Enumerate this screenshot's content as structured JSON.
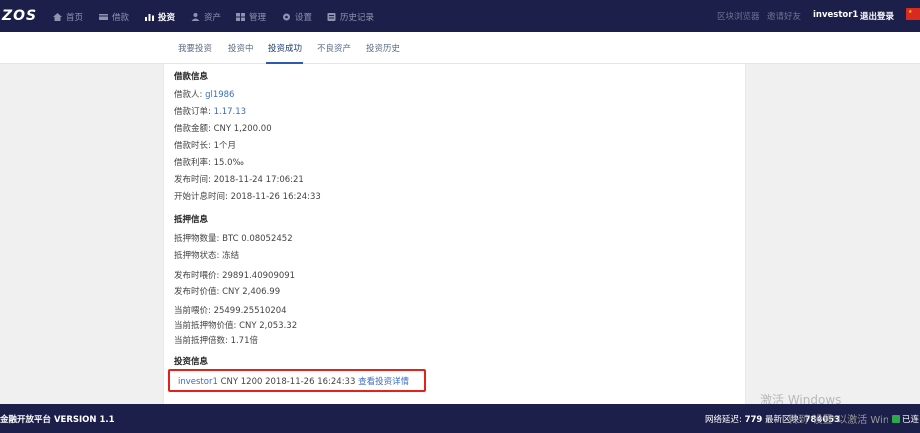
{
  "topbar": {
    "logo": "ZOS",
    "nav": [
      {
        "label": "首页",
        "icon": "home-icon"
      },
      {
        "label": "借款",
        "icon": "card-icon"
      },
      {
        "label": "投资",
        "icon": "bar-chart-icon"
      },
      {
        "label": "资产",
        "icon": "user-icon"
      },
      {
        "label": "管理",
        "icon": "grid-icon"
      },
      {
        "label": "设置",
        "icon": "gear-icon"
      },
      {
        "label": "历史记录",
        "icon": "history-icon"
      }
    ],
    "block_explorer": "区块浏览器",
    "invite": "邀请好友",
    "username": "investor1",
    "logout": "退出登录"
  },
  "subtabs": [
    "我要投资",
    "投资中",
    "投资成功",
    "不良资产",
    "投资历史"
  ],
  "loan_info": {
    "title": "借款信息",
    "borrower_label": "借款人: ",
    "borrower": "gl1986",
    "order_label": "借款订单: ",
    "order": "1.17.13",
    "amount": "借款金额: CNY 1,200.00",
    "duration": "借款时长: 1个月",
    "rate": "借款利率: 15.0‰",
    "published": "发布时间: 2018-11-24 17:06:21",
    "interest_start": "开始计息时间: 2018-11-26 16:24:33"
  },
  "collateral_info": {
    "title": "抵押信息",
    "quantity": "抵押物数量: BTC 0.08052452",
    "status": "抵押物状态: 冻结",
    "feed_price_at_publish": "发布时喂价: 29891.40909091",
    "value_at_publish": "发布时价值: CNY 2,406.99",
    "current_feed_price": "当前喂价: 25499.25510204",
    "current_value": "当前抵押物价值: CNY 2,053.32",
    "current_ratio": "当前抵押倍数: 1.71倍"
  },
  "investment_info": {
    "title": "投资信息",
    "investor": "investor1",
    "detail": " CNY 1200 2018-11-26 16:24:33 ",
    "view_link": "查看投资详情"
  },
  "footer": {
    "version": "金融开放平台 VERSION 1.1",
    "latency_label": "网络延迟: ",
    "latency": "779",
    "block_label": "最新区块: ",
    "block": "784053",
    "connected": "已连"
  },
  "watermark": {
    "line1": "激活 Windows",
    "line2": "转到\"设置\"以激活 Windows。"
  },
  "colors": {
    "nav_bg": "#1b1f4a",
    "link": "#3a6bc7",
    "highlight_border": "#e5221a"
  }
}
